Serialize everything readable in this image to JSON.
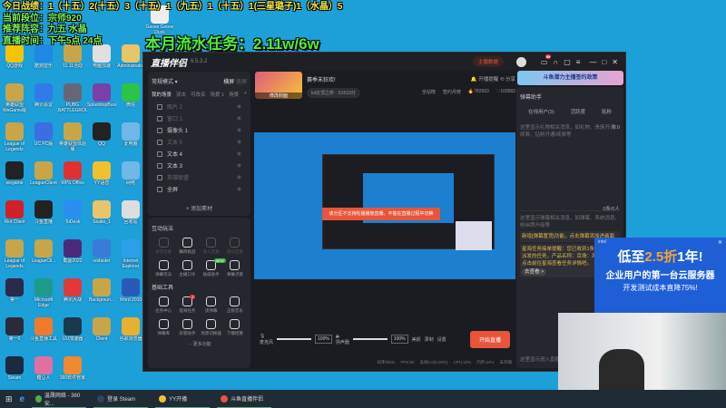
{
  "overlay": {
    "lines": [
      "今日战绩：1（十五）2(十五）3（十五）1（九五）1（十五）1(三星璐子)1（水晶）5",
      "当前段位：宗师920",
      "推荐阵容：九五 水晶",
      "直播时间：下午5点 24点"
    ],
    "goal": "本月流水任务：2.11w/6w"
  },
  "desktop_icons": [
    {
      "label": "Goose Goose Duck",
      "color": "#eee"
    },
    {
      "label": "QQ游戏",
      "color": "#f5c400"
    },
    {
      "label": "酷狗音乐",
      "color": "#1e88e5"
    },
    {
      "label": "11.11活动",
      "color": "#c9a54a"
    },
    {
      "label": "电脑加速",
      "color": "#e0e0e0"
    },
    {
      "label": "Administrator",
      "color": "#e8c46a"
    },
    {
      "label": "英雄联盟WeGame版",
      "color": "#c9a54a"
    },
    {
      "label": "腾讯会议",
      "color": "#2f7bea"
    },
    {
      "label": "PUBG BATTLEGROUNDS",
      "color": "#667"
    },
    {
      "label": "SplashtopBusiness",
      "color": "#7b3fa8"
    },
    {
      "label": "微信",
      "color": "#2dc24a"
    },
    {
      "label": "League of Legends",
      "color": "#c9a54a"
    },
    {
      "label": "UC PC版",
      "color": "#3b6ee0"
    },
    {
      "label": "英雄联盟体验服",
      "color": "#c9a54a"
    },
    {
      "label": "QQ",
      "color": "#222"
    },
    {
      "label": "此电脑",
      "color": "#6fb8e8"
    },
    {
      "label": "wegame",
      "color": "#222"
    },
    {
      "label": "LeagueClient",
      "color": "#c9a54a"
    },
    {
      "label": "WPS Office",
      "color": "#e03030"
    },
    {
      "label": "YY语音",
      "color": "#f0c030"
    },
    {
      "label": "网络",
      "color": "#6fb8e8"
    },
    {
      "label": "Riot Client",
      "color": "#d0202a"
    },
    {
      "label": "斗鱼直播",
      "color": "#222"
    },
    {
      "label": "ToDesk",
      "color": "#2a8ef0"
    },
    {
      "label": "Studio_1",
      "color": "#e8c46a"
    },
    {
      "label": "回收站",
      "color": "#ddd"
    },
    {
      "label": "League of Legends",
      "color": "#c9a54a"
    },
    {
      "label": "LeagueCli...",
      "color": "#c9a54a"
    },
    {
      "label": "截图2022",
      "color": "#4a2a7a"
    },
    {
      "label": "sodaster",
      "color": "#3a7ad8"
    },
    {
      "label": "Internet Explorer",
      "color": "#2aa0e8"
    },
    {
      "label": "第一",
      "color": "#2a2a4a"
    },
    {
      "label": "Microsoft Edge",
      "color": "#1e9a8a"
    },
    {
      "label": "腾讯大战",
      "color": "#e03a3a"
    },
    {
      "label": "Backgroun...",
      "color": "#c9a54a"
    },
    {
      "label": "Word 2010",
      "color": "#2a5ab8"
    },
    {
      "label": "第一0",
      "color": "#2a2a3a"
    },
    {
      "label": "斗鱼直播工具",
      "color": "#f07a2a"
    },
    {
      "label": "UU加速器",
      "color": "#1a3a4a"
    },
    {
      "label": "Client",
      "color": "#c9a54a"
    },
    {
      "label": "谷歌浏览器",
      "color": "#e8b030"
    },
    {
      "label": "Steam",
      "color": "#1a2a40"
    },
    {
      "label": "糖豆人",
      "color": "#e070a0"
    },
    {
      "label": "360软件管家",
      "color": "#f08a30"
    }
  ],
  "app": {
    "name": "直播伴侣",
    "version": "6.5.3.2",
    "live_data": "主播数据",
    "share": "分享",
    "start_reminder": "开播提醒",
    "left": {
      "mode": "常规模式",
      "lock": "横屏",
      "portrait": "竖屏",
      "tabs": [
        "我的场景",
        "双击",
        "可改名",
        "场景 1",
        "场景"
      ],
      "sources": [
        {
          "name": "图片 2",
          "dim": true
        },
        {
          "name": "窗口 1",
          "dim": true
        },
        {
          "name": "摄像头 1",
          "dim": false
        },
        {
          "name": "文本 5",
          "dim": true
        },
        {
          "name": "文本 4",
          "dim": false
        },
        {
          "name": "文本 3",
          "dim": false
        },
        {
          "name": "英雄联盟",
          "dim": true
        },
        {
          "name": "全屏",
          "dim": false
        }
      ],
      "add_source": "+ 添加素材",
      "interactive_title": "互动玩法",
      "interactive": [
        {
          "name": "语音连麦",
          "dim": true
        },
        {
          "name": "瞩目挑战",
          "dim": false
        },
        {
          "name": "多人连麦",
          "dim": true
        },
        {
          "name": "观众连麦",
          "dim": true
        },
        {
          "name": "弹幕玩法",
          "dim": false
        },
        {
          "name": "主播口令",
          "dim": false
        },
        {
          "name": "贴纸助手",
          "dim": false
        },
        {
          "name": "弹幕点歌",
          "dim": false
        }
      ],
      "new_badge": "NEW",
      "tools_title": "基础工具",
      "tools": [
        {
          "name": "任务中心",
          "dim": false
        },
        {
          "name": "提海任务",
          "dim": false
        },
        {
          "name": "读弹幕",
          "dim": false
        },
        {
          "name": "正版音乐",
          "dim": false
        },
        {
          "name": "弹幕库",
          "dim": false
        },
        {
          "name": "房管助手",
          "dim": false
        },
        {
          "name": "场景切换器",
          "dim": false
        },
        {
          "name": "下播结算",
          "dim": false
        }
      ],
      "tools_badge": "2",
      "more": "··· 更多功能"
    },
    "room": {
      "title": "赛季末狂欢!",
      "cover_label": "修改封面",
      "category": "lol云顶之弈 - S1510分",
      "rank": "全站榜",
      "monthly": "签约月榜",
      "heat": "782663",
      "fans": "103582"
    },
    "toast": "该分区不支持轮播播放直播。不能在直播过程中切换",
    "controls": {
      "mic": "麦克风",
      "mic_vol": "100%",
      "speaker": "扬声器",
      "speaker_vol": "100%",
      "beauty": "美颜",
      "record": "录制",
      "settings": "设置",
      "start": "开始直播"
    },
    "status": [
      "码率0kb/s",
      "FPS:60",
      "丢帧0.0(0.00%)",
      "CPU:10%",
      "内存:24%",
      "未开播"
    ],
    "right": {
      "banner": "斗鱼潜力主播签约政策",
      "title": "弹幕助手",
      "tabs": [
        "在线用户(3)",
        "活跃度",
        "贴粉"
      ],
      "gift_hint": "这里显示礼物相关消息，如礼物、贵族开通/续费、钻粉开通/续费等",
      "gift_val": "0.0",
      "danmu_count": "0条/0人",
      "danmu_hint": "这里显示弹幕相关消息，如弹幕、系统消息、粉丝牌升级等",
      "notice1": "新增[弹幕置顶]功能，点击弹幕添加进画面",
      "notice2": "星海任务接单提醒：您已收到1条星海平台派发的任务，产品名称：百场：风之回响，点击前往星海查看任务详情吧。",
      "go_view": "去查看 >",
      "bottom_hint": "这里显示进入直播间消息"
    },
    "notif_badge": "99"
  },
  "ad": {
    "line1_pre": "低至",
    "line1_hl": "2.5折",
    "line1_post": "1年!",
    "line2": "企业用户的第一台云服务器",
    "line3": "开发测试成本直降75%!",
    "brand": "intel"
  },
  "taskbar": [
    {
      "label": "温晟网络 - 360安...",
      "color": "#4caf50"
    },
    {
      "label": "登录 Steam",
      "color": "#2a475e"
    },
    {
      "label": "YY开播",
      "color": "#f0c030"
    },
    {
      "label": "斗鱼直播伴侣",
      "color": "#e8553a"
    }
  ]
}
